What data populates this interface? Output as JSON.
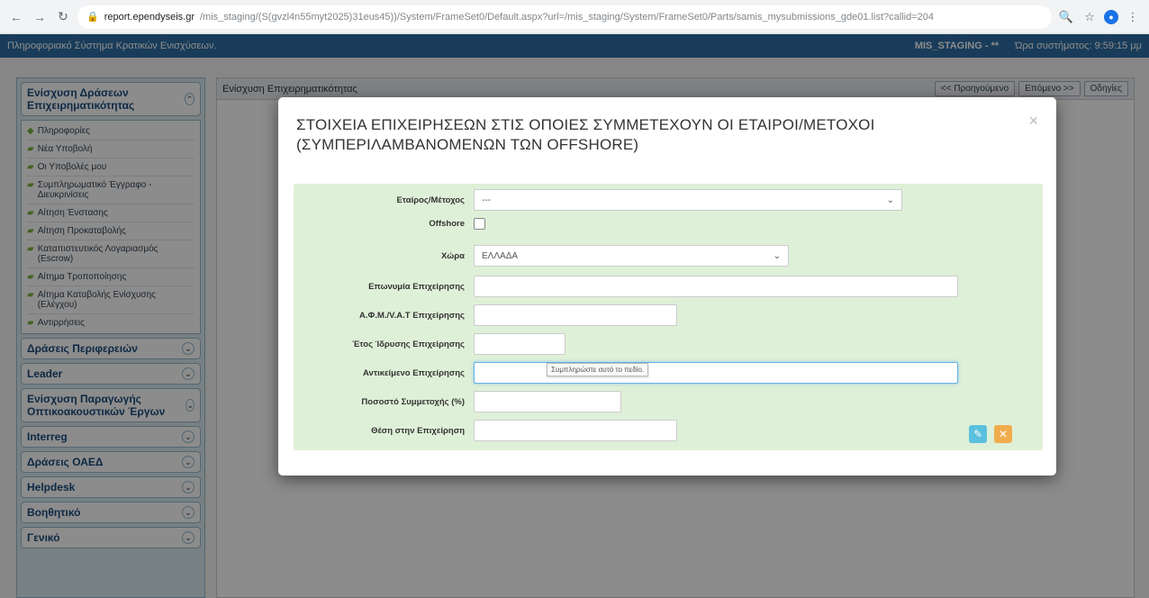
{
  "browser": {
    "url_host": "report.ependyseis.gr",
    "url_rest": "/mis_staging/(S(gvzl4n55myt2025)31eus45))/System/FrameSet0/Default.aspx?url=/mis_staging/System/FrameSet0/Parts/samis_mysubmissions_gde01.list?callid=204"
  },
  "header": {
    "app_title": "Πληροφοριακό Σύστημα Κρατικών Ενισχύσεων.",
    "env_name": "MIS_STAGING - **",
    "session_time": "Ώρα συστήματος: 9:59:15 μμ"
  },
  "sidebar": {
    "section_active": "Ενίσχυση Δράσεων Επιχειρηματικότητας",
    "items": [
      "Πληροφορίες",
      "Νέα Υποβολή",
      "Οι Υποβολές μου",
      "Συμπληρωματικό Έγγραφο - Διευκρινίσεις",
      "Αίτηση Ένστασης",
      "Αίτηση Προκαταβολής",
      "Καταπιστευτικός Λογαριασμός (Escrow)",
      "Αίτημα Τροποποίησης",
      "Αίτημα Καταβολής Ενίσχυσης (Ελέγχου)",
      "Αντιρρήσεις"
    ],
    "sections": [
      "Δράσεις Περιφερειών",
      "Leader",
      "Ενίσχυση Παραγωγής Οπτικοακουστικών Έργων",
      "Interreg",
      "Δράσεις ΟΑΕΔ",
      "Helpdesk",
      "Βοηθητικό",
      "Γενικό"
    ]
  },
  "main": {
    "tab_title": "Ενίσχυση Επιχειρηματικότητας",
    "prev_label": "<< Προηγούμενο",
    "next_label": "Επόμενο >>",
    "help_label": "Οδηγίες"
  },
  "modal": {
    "title": "ΣΤΟΙΧΕΙΑ ΕΠΙΧΕΙΡΗΣΕΩΝ ΣΤΙΣ ΟΠΟΙΕΣ ΣΥΜΜΕΤΕΧΟΥΝ ΟΙ ΕΤΑΙΡΟΙ/ΜΕΤΟΧΟΙ (ΣΥΜΠΕΡΙΛΑΜΒΑΝΟΜΕΝΩΝ ΤΩΝ OFFSHORE)",
    "close_glyph": "×",
    "fields": {
      "partner_label": "Εταίρος/Μέτοχος",
      "partner_value": "---",
      "offshore_label": "Offshore",
      "country_label": "Χώρα",
      "country_value": "ΕΛΛΑΔΑ",
      "name_label": "Επωνυμία Επιχείρησης",
      "vat_label": "Α.Φ.Μ./V.A.T Επιχείρησης",
      "year_label": "Έτος Ίδρυσης Επιχείρησης",
      "object_label": "Αντικείμενο Επιχείρησης",
      "percent_label": "Ποσοστό Συμμετοχής (%)",
      "position_label": "Θέση στην Επιχείρηση"
    },
    "tooltip": "Συμπληρώστε αυτό το πεδίο."
  }
}
